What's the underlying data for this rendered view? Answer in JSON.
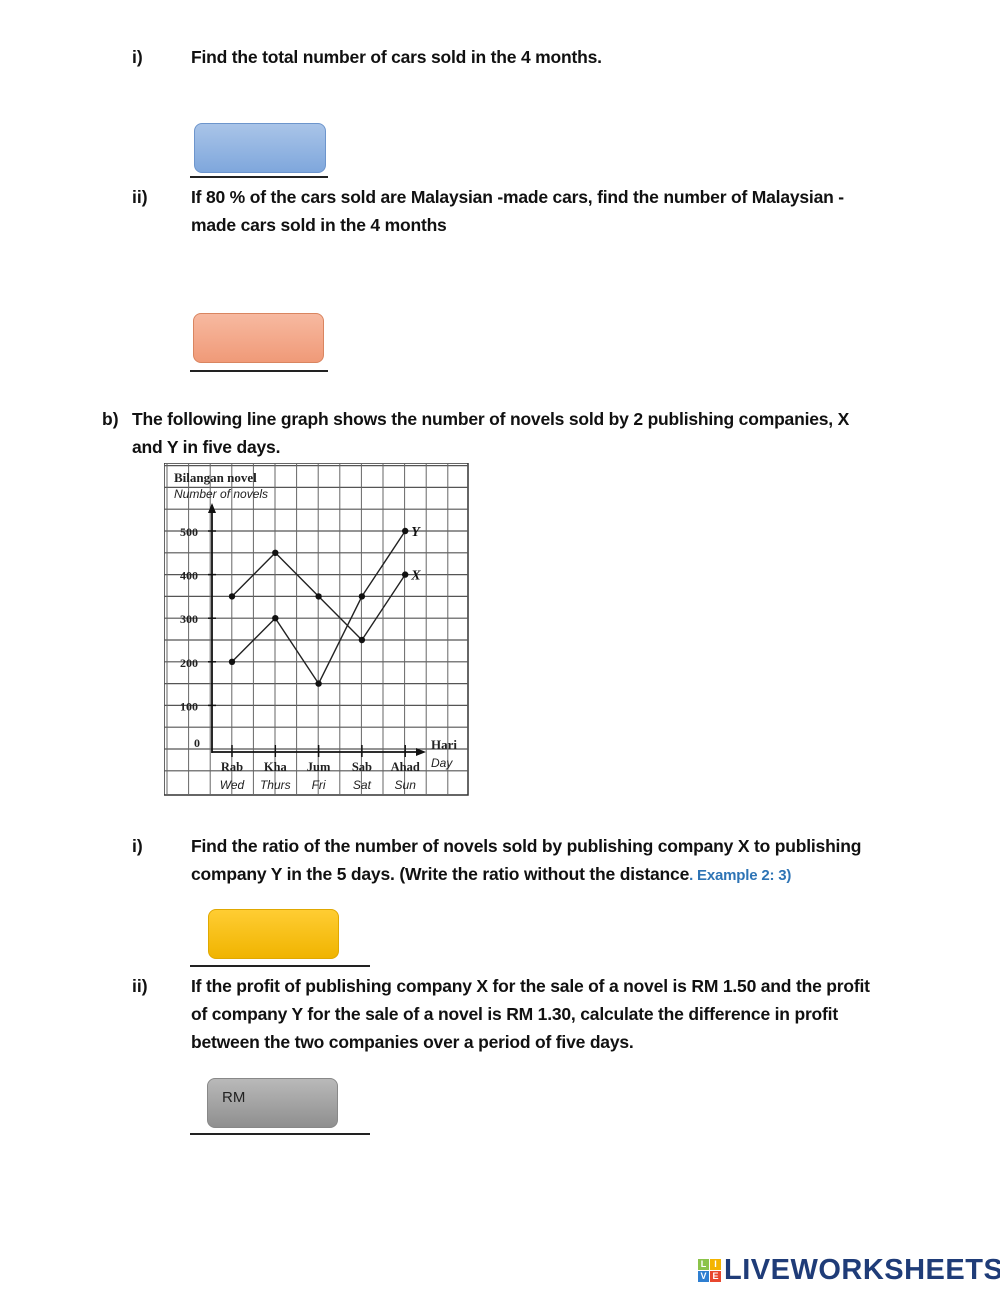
{
  "questions": {
    "a_i": {
      "number": "i)",
      "text": "Find the total number of cars sold in the 4 months."
    },
    "a_ii": {
      "number": "ii)",
      "line1": "If 80 % of the cars sold are Malaysian -made cars, find the number of Malaysian -",
      "line2": "made cars sold in the 4 months"
    },
    "b": {
      "number": "b)",
      "line1": "The following line graph shows the number of novels sold by 2 publishing companies, X",
      "line2": "and Y in five days."
    },
    "b_i": {
      "number": "i)",
      "line1": "Find the ratio of the number of novels sold by publishing company X to publishing",
      "line2": "company Y in the 5 days. (Write the ratio without the distance",
      "example": ". Example 2: 3)"
    },
    "b_ii": {
      "number": "ii)",
      "line1": "If the profit of publishing company X for the sale of a novel is RM 1.50 and the profit",
      "line2": "of company Y for the sale of a novel is RM 1.30, calculate the difference in profit",
      "line3": "between the two companies over a period of five days."
    }
  },
  "answers": {
    "a_i": {
      "value": "",
      "color": "#8fb3e2"
    },
    "a_ii": {
      "value": "",
      "color": "#f4aa8c"
    },
    "b_i": {
      "value": "",
      "color": "#fbc11a"
    },
    "b_ii": {
      "prefix": "RM",
      "value": "",
      "color": "#a6a6a6"
    }
  },
  "chart_data": {
    "type": "line",
    "title": "",
    "ylabel": "Bilangan novel",
    "ylabel_en": "Number of novels",
    "xlabel": "Hari",
    "xlabel_en": "Day",
    "categories": [
      "Rab",
      "Kha",
      "Jum",
      "Sab",
      "Ahad"
    ],
    "categories_en": [
      "Wed",
      "Thurs",
      "Fri",
      "Sat",
      "Sun"
    ],
    "yticks": [
      0,
      100,
      200,
      300,
      400,
      500
    ],
    "ylim": [
      0,
      550
    ],
    "grid": true,
    "series": [
      {
        "name": "X",
        "values": [
          350,
          450,
          350,
          250,
          400
        ]
      },
      {
        "name": "Y",
        "values": [
          200,
          300,
          150,
          350,
          500
        ]
      }
    ]
  },
  "branding": {
    "logo_cells": [
      "L",
      "I",
      "V",
      "E"
    ],
    "logo_text": "LIVEWORKSHEETS"
  }
}
